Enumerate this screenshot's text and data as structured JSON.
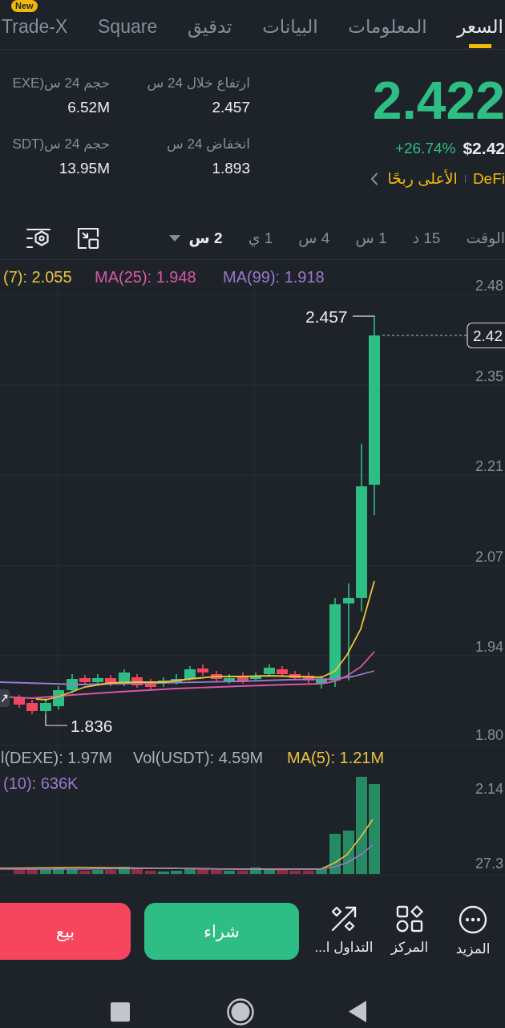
{
  "tabs": [
    {
      "label": "السعر",
      "selected": true
    },
    {
      "label": "المعلومات",
      "selected": false
    },
    {
      "label": "البيانات",
      "selected": false
    },
    {
      "label": "تدقيق",
      "selected": false
    },
    {
      "label": "Square",
      "selected": false
    },
    {
      "label": "Trade-X",
      "selected": false,
      "badge": "New"
    }
  ],
  "ticker": {
    "price": "2.422",
    "price_usd": "$2.42",
    "change": "+26.74%",
    "tags": [
      "DeFi",
      "الأعلى ربحًا"
    ]
  },
  "stats": [
    {
      "label": "ارتفاع خلال 24 س",
      "value": "2.457"
    },
    {
      "label": "حجم 24 س(EXE",
      "value": "6.52M"
    },
    {
      "label": "انخفاض 24 س",
      "value": "1.893"
    },
    {
      "label": "حجم 24 س(SDT",
      "value": "13.95M"
    }
  ],
  "timeframes": [
    {
      "label": "الوقت",
      "selected": false
    },
    {
      "label": "15 د",
      "selected": false
    },
    {
      "label": "1 س",
      "selected": false
    },
    {
      "label": "4 س",
      "selected": false
    },
    {
      "label": "1 ي",
      "selected": false
    },
    {
      "label": "2 س",
      "selected": true
    }
  ],
  "chart": {
    "ma_legend": [
      {
        "text": "MA(99): 1.918",
        "color": "#9b78cb"
      },
      {
        "text": "MA(25): 1.948",
        "color": "#d957a6"
      },
      {
        "text": "(7): 2.055",
        "color": "#e9c23c"
      }
    ],
    "price_axis": [
      "2.48",
      "2.35",
      "2.21",
      "2.07",
      "1.94",
      "1.80"
    ],
    "high_label": "2.457",
    "low_label": "1.836",
    "current_price": "2.42"
  },
  "volume": {
    "legend": [
      {
        "text": "MA(5): 1.21M",
        "color": "#e9c23c"
      },
      {
        "text": "Vol(USDT): 4.59M",
        "color": "#aab0b8"
      },
      {
        "text": "l(DEXE): 1.97M",
        "color": "#aab0b8"
      },
      {
        "text": "(10): 636K",
        "color": "#9b78cb"
      }
    ],
    "axis": [
      "2.14",
      "27.3"
    ]
  },
  "actions": [
    {
      "label": "المزيد",
      "kind": "more"
    },
    {
      "label": "المركز",
      "kind": "position"
    },
    {
      "label": "التداول ا...",
      "kind": "trade"
    }
  ],
  "buttons": [
    {
      "label": "شراء",
      "kind": "buy"
    },
    {
      "label": "بيع",
      "kind": "sell"
    }
  ]
}
